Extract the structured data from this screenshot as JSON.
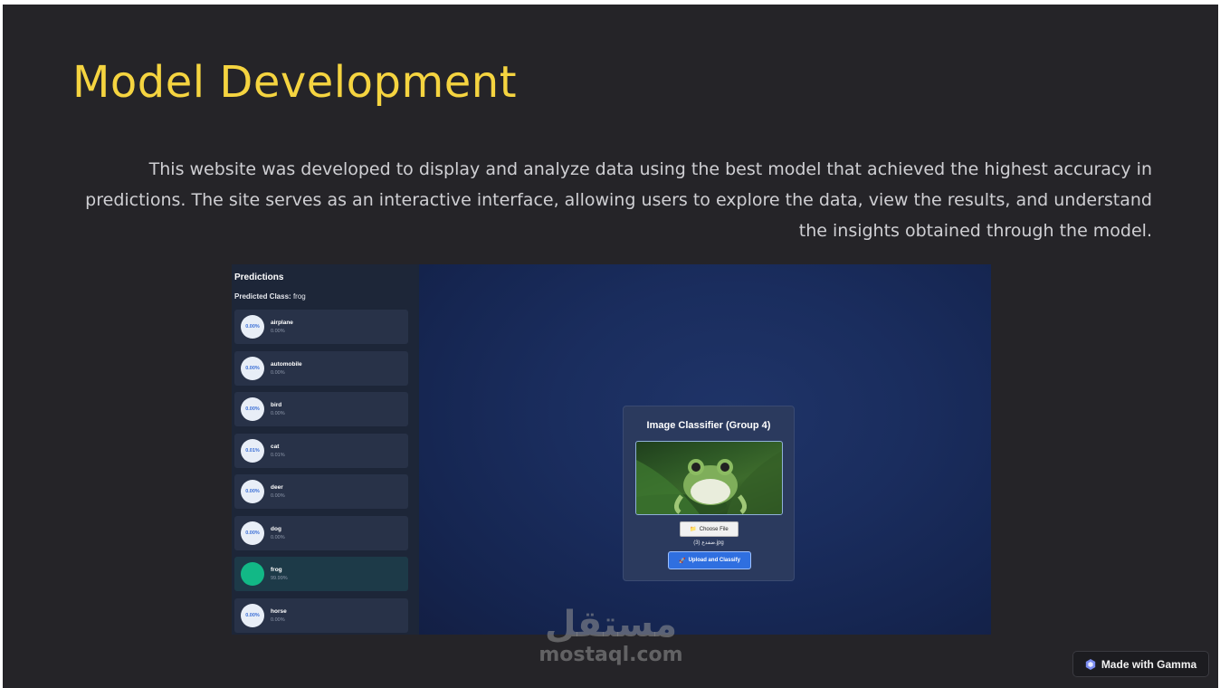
{
  "slide": {
    "title": "Model Development",
    "description": "This website was developed to display and analyze data using the best model that achieved the highest accuracy in predictions. The site serves as an interactive interface, allowing users to explore the data, view the results, and understand the insights obtained through the model."
  },
  "app": {
    "sidebar": {
      "title": "Predictions",
      "predicted_label": "Predicted Class:",
      "predicted_value": "frog",
      "items": [
        {
          "name": "airplane",
          "badge": "0.00%",
          "value": "0.00%"
        },
        {
          "name": "automobile",
          "badge": "0.00%",
          "value": "0.00%"
        },
        {
          "name": "bird",
          "badge": "0.00%",
          "value": "0.00%"
        },
        {
          "name": "cat",
          "badge": "0.01%",
          "value": "0.01%"
        },
        {
          "name": "deer",
          "badge": "0.00%",
          "value": "0.00%"
        },
        {
          "name": "dog",
          "badge": "0.00%",
          "value": "0.00%"
        },
        {
          "name": "frog",
          "badge": "99.99%",
          "value": "99.99%"
        },
        {
          "name": "horse",
          "badge": "0.00%",
          "value": "0.00%"
        }
      ]
    },
    "card": {
      "title": "Image Classifier (Group 4)",
      "choose_file_icon": "folder-icon",
      "choose_file_label": "Choose File",
      "file_name": "(3) ضفدع.jpg",
      "upload_icon": "rocket-icon",
      "upload_label": "Upload and Classify"
    }
  },
  "watermark": {
    "arabic": "مستقل",
    "latin": "mostaql.com"
  },
  "badge": {
    "icon": "gamma-icon",
    "label": "Made with Gamma"
  },
  "colors": {
    "title": "#f5d440",
    "slide_bg": "#252428",
    "accent_green": "#12b886",
    "button_blue": "#2f6fe0"
  }
}
